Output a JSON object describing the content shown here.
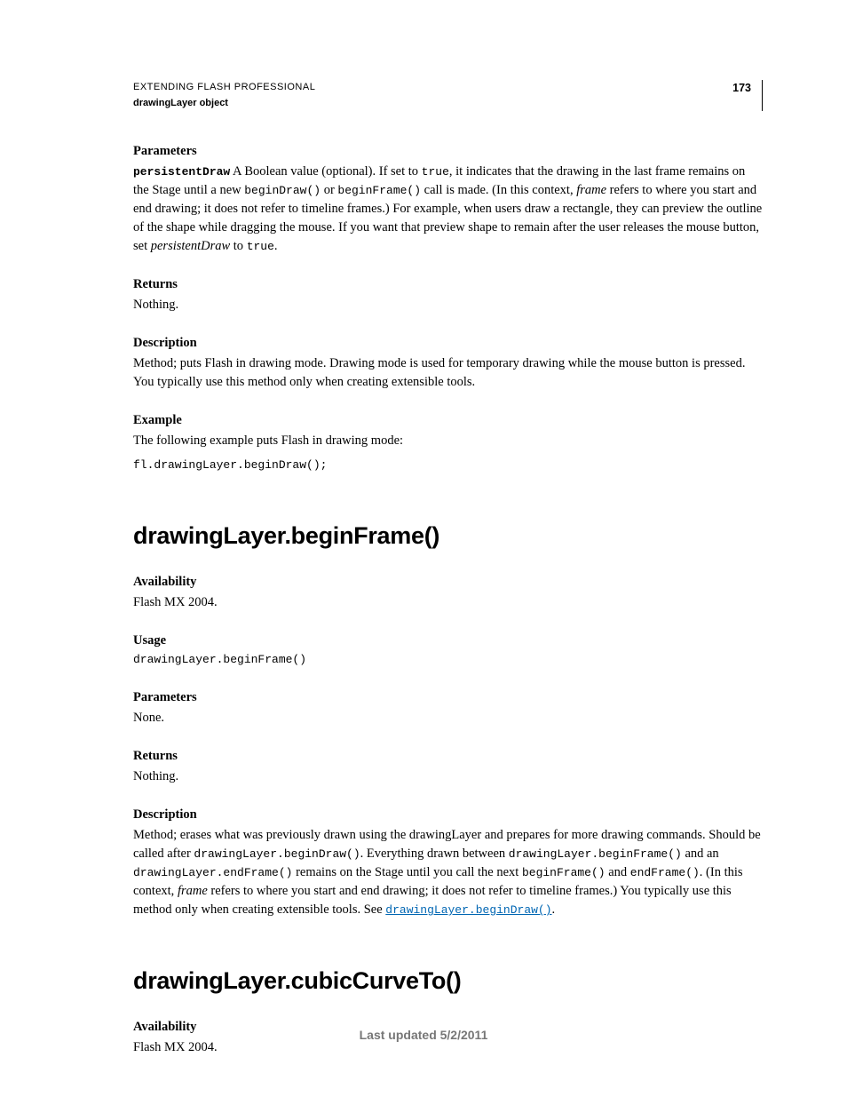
{
  "header": {
    "title": "EXTENDING FLASH PROFESSIONAL",
    "subtitle": "drawingLayer object",
    "pageNum": "173"
  },
  "s1": {
    "parameters_label": "Parameters",
    "param_name": "persistentDraw",
    "p1a": "   A Boolean value (optional). If set to ",
    "c1": "true",
    "p1b": ", it indicates that the drawing in the last frame remains on the Stage until a new ",
    "c2": "beginDraw()",
    "p1c": " or ",
    "c3": "beginFrame()",
    "p1d": " call is made. (In this context, ",
    "em1": "frame",
    "p1e": " refers to where you start and end drawing; it does not refer to timeline frames.) For example, when users draw a rectangle, they can preview the outline of the shape while dragging the mouse. If you want that preview shape to remain after the user releases the mouse button, set ",
    "em2": "persistentDraw",
    "p1f": " to ",
    "c4": "true",
    "p1g": ".",
    "returns_label": "Returns",
    "returns_text": "Nothing.",
    "desc_label": "Description",
    "desc_text": "Method; puts Flash in drawing mode. Drawing mode is used for temporary drawing while the mouse button is pressed. You typically use this method only when creating extensible tools.",
    "ex_label": "Example",
    "ex_text": "The following example puts Flash in drawing mode:",
    "ex_code": "fl.drawingLayer.beginDraw();"
  },
  "s2": {
    "heading": "drawingLayer.beginFrame()",
    "avail_label": "Availability",
    "avail_text": "Flash MX 2004.",
    "usage_label": "Usage",
    "usage_code": "drawingLayer.beginFrame()",
    "params_label": "Parameters",
    "params_text": "None.",
    "returns_label": "Returns",
    "returns_text": "Nothing.",
    "desc_label": "Description",
    "d1": "Method; erases what was previously drawn using the drawingLayer and prepares for more drawing commands. Should be called after ",
    "c1": "drawingLayer.beginDraw()",
    "d2": ". Everything drawn between ",
    "c2": "drawingLayer.beginFrame()",
    "d3": " and an ",
    "c3": "drawingLayer.endFrame()",
    "d4": " remains on the Stage until you call the next ",
    "c4": "beginFrame()",
    "d5": " and ",
    "c5": "endFrame()",
    "d6": ". (In this context, ",
    "em1": "frame",
    "d7": " refers to where you start and end drawing; it does not refer to timeline frames.) You typically use this method only when creating extensible tools. See ",
    "link": "drawingLayer.beginDraw()",
    "d8": "."
  },
  "s3": {
    "heading": "drawingLayer.cubicCurveTo()",
    "avail_label": "Availability",
    "avail_text": "Flash MX 2004."
  },
  "footer": "Last updated 5/2/2011"
}
